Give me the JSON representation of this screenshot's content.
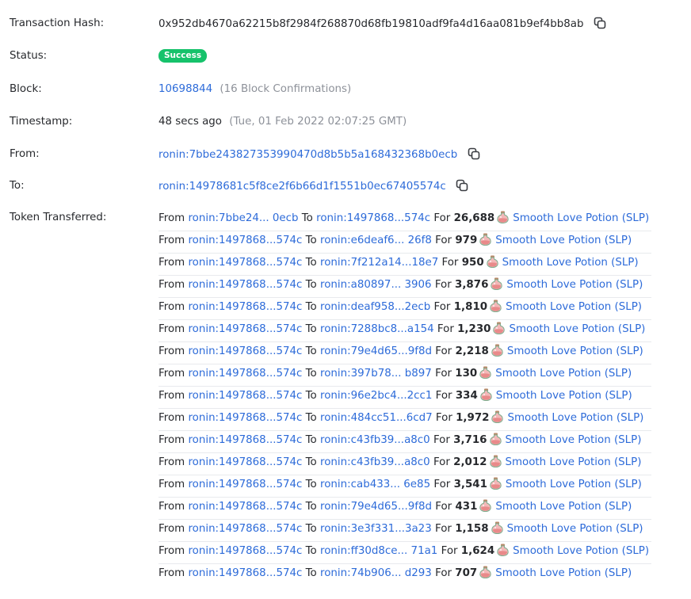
{
  "fields": {
    "tx_hash_label": "Transaction Hash:",
    "tx_hash": "0x952db4670a62215b8f2984f268870d68fb19810adf9fa4d16aa081b9ef4bb8ab",
    "status_label": "Status:",
    "status": "Success",
    "block_label": "Block:",
    "block_number": "10698844",
    "block_confirmations": "(16 Block Confirmations)",
    "timestamp_label": "Timestamp:",
    "timestamp_relative": "48 secs ago",
    "timestamp_full": "(Tue, 01 Feb 2022 02:07:25 GMT)",
    "from_label": "From:",
    "from_address": "ronin:7bbe243827353990470d8b5b5a168432368b0ecb",
    "to_label": "To:",
    "to_address": "ronin:14978681c5f8ce2f6b66d1f1551b0ec67405574c",
    "tokens_label": "Token Transferred:"
  },
  "transfer_words": {
    "from": "From",
    "to": "To",
    "for": "For"
  },
  "token_name": "Smooth Love Potion (SLP)",
  "colors": {
    "link": "#2d6bd9",
    "success": "#16c26b",
    "text": "#27292d",
    "muted": "#8d9199"
  },
  "transfers": [
    {
      "from": "ronin:7bbe24... 0ecb",
      "to": "ronin:1497868...574c",
      "amount": "26,688"
    },
    {
      "from": "ronin:1497868...574c",
      "to": "ronin:e6deaf6... 26f8",
      "amount": "979"
    },
    {
      "from": "ronin:1497868...574c",
      "to": "ronin:7f212a14...18e7",
      "amount": "950"
    },
    {
      "from": "ronin:1497868...574c",
      "to": "ronin:a80897... 3906",
      "amount": "3,876"
    },
    {
      "from": "ronin:1497868...574c",
      "to": "ronin:deaf958...2ecb",
      "amount": "1,810"
    },
    {
      "from": "ronin:1497868...574c",
      "to": "ronin:7288bc8...a154",
      "amount": "1,230"
    },
    {
      "from": "ronin:1497868...574c",
      "to": "ronin:79e4d65...9f8d",
      "amount": "2,218"
    },
    {
      "from": "ronin:1497868...574c",
      "to": "ronin:397b78... b897",
      "amount": "130"
    },
    {
      "from": "ronin:1497868...574c",
      "to": "ronin:96e2bc4...2cc1",
      "amount": "334"
    },
    {
      "from": "ronin:1497868...574c",
      "to": "ronin:484cc51...6cd7",
      "amount": "1,972"
    },
    {
      "from": "ronin:1497868...574c",
      "to": "ronin:c43fb39...a8c0",
      "amount": "3,716"
    },
    {
      "from": "ronin:1497868...574c",
      "to": "ronin:c43fb39...a8c0",
      "amount": "2,012"
    },
    {
      "from": "ronin:1497868...574c",
      "to": "ronin:cab433... 6e85",
      "amount": "3,541"
    },
    {
      "from": "ronin:1497868...574c",
      "to": "ronin:79e4d65...9f8d",
      "amount": "431"
    },
    {
      "from": "ronin:1497868...574c",
      "to": "ronin:3e3f331...3a23",
      "amount": "1,158"
    },
    {
      "from": "ronin:1497868...574c",
      "to": "ronin:ff30d8ce... 71a1",
      "amount": "1,624"
    },
    {
      "from": "ronin:1497868...574c",
      "to": "ronin:74b906... d293",
      "amount": "707"
    }
  ]
}
